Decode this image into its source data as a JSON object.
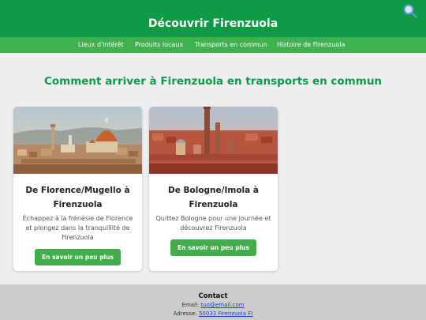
{
  "header": {
    "title": "Découvrir Firenzuola",
    "search_icon": "search-icon"
  },
  "nav": {
    "items": [
      {
        "label": "Lieux d'intérêt"
      },
      {
        "label": "Produits locaux"
      },
      {
        "label": "Transports en commun"
      },
      {
        "label": "Histoire de Firenzuola"
      }
    ]
  },
  "main": {
    "heading": "Comment arriver à Firenzuola en transports en commun",
    "cards": [
      {
        "title_line1": "De Florence/Mugello à",
        "title_line2": "Firenzuola",
        "text_line1": "Échappez à la frénésie de Florence",
        "text_line2": "et plongez dans la tranquillité de",
        "text_line3": "Firenzuola",
        "button_label": "En savoir un peu plus"
      },
      {
        "title_line1": "De Bologne/Imola à",
        "title_line2": "Firenzuola",
        "text_line1": "Quittez Bologne pour une journée et",
        "text_line2": "découvrez Firenzuola",
        "button_label": "En savoir un peu plus"
      }
    ]
  },
  "footer": {
    "title": "Contact",
    "email_label": "Email: ",
    "email_value": "tuo@email.com",
    "address_label": "Adresse: ",
    "address_value": "50033 Firenzuola FI"
  },
  "colors": {
    "header_green": "#0e9a47",
    "nav_green": "#3fb24f",
    "button_green": "#43ad4c",
    "page_background": "#eeeeee",
    "footer_background": "#cccccc",
    "link_blue": "#1a3fc9"
  }
}
